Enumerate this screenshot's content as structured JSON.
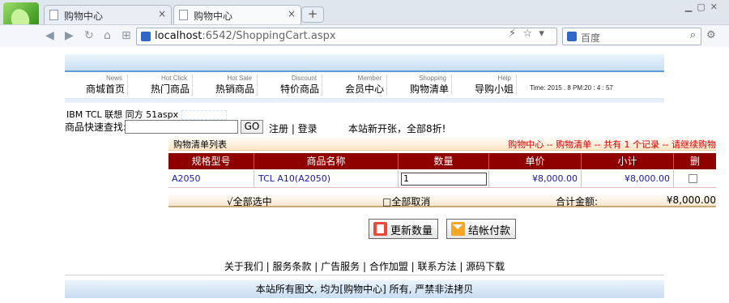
{
  "browser": {
    "tabs": [
      {
        "label": "购物中心",
        "close": "×"
      },
      {
        "label": "购物中心",
        "close": "×"
      }
    ],
    "newtab": "+",
    "url_host": "localhost",
    "url_rest": ":6542/ShoppingCart.aspx",
    "search_placeholder": "百度"
  },
  "menu": [
    {
      "en": "News",
      "cn": "商城首页"
    },
    {
      "en": "Hot Click",
      "cn": "热门商品"
    },
    {
      "en": "Hot Sale",
      "cn": "热销商品"
    },
    {
      "en": "Discount",
      "cn": "特价商品"
    },
    {
      "en": "Member",
      "cn": "会员中心"
    },
    {
      "en": "Shopping",
      "cn": "购物清单"
    },
    {
      "en": "Help",
      "cn": "导购小姐"
    }
  ],
  "clock": "Time:  2015 . 8  PM:20  :  4  :  57",
  "brands": "IBM TCL 联想 同方 51aspx",
  "quick_label": "商品快速查找:",
  "go": "GO",
  "reg_login": "注册 | 登录",
  "notice": "本站新开张，全部8折!",
  "cart": {
    "title": "购物清单列表",
    "crumb": "购物中心 -- 购物清单 -- 共有 1 个记录 -- 请继续购物",
    "headers": [
      "规格型号",
      "商品名称",
      "数量",
      "单价",
      "小计",
      "删"
    ],
    "rows": [
      {
        "model": "A2050",
        "name": "TCL A10(A2050)",
        "qty": "1",
        "price": "¥8,000.00",
        "subtotal": "¥8,000.00"
      }
    ],
    "select_all": "√全部选中",
    "cancel_all": "□全部取消",
    "total_label": "合计金额:",
    "total_value": "¥8,000.00"
  },
  "buttons": {
    "update": "更新数量",
    "checkout": "结帐付款"
  },
  "footer_links": "关于我们 | 服务条款 | 广告服务 | 合作加盟 | 联系方法 | 源码下载",
  "copyright": "本站所有图文, 均为[购物中心] 所有, 严禁非法拷贝"
}
